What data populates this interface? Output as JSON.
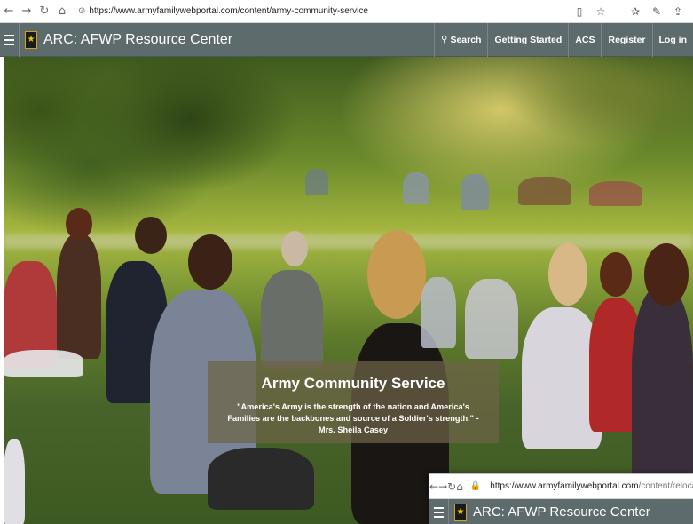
{
  "browser": {
    "url": "https://www.armyfamilywebportal.com/content/army-community-service",
    "back_icon": "←",
    "forward_icon": "→",
    "refresh_icon": "↻",
    "home_icon": "⌂",
    "lock_icon": "🔒"
  },
  "site": {
    "title": "ARC: AFWP Resource Center",
    "logo_glyph": "★",
    "nav": [
      {
        "label": "Search",
        "icon": "🔍"
      },
      {
        "label": "Getting Started"
      },
      {
        "label": "ACS"
      },
      {
        "label": "Register"
      },
      {
        "label": "Log in"
      }
    ]
  },
  "hero": {
    "heading": "Army Community Service",
    "quote": "\"America's Army is the strength of the nation and America's Families are the backbones and source of a Soldier's strength.\" - Mrs. Sheila Casey"
  },
  "second_window": {
    "url_host": "https://www.armyfamilywebportal.com",
    "url_path": "/content/relocation-readiness",
    "title": "ARC: AFWP Resource Center"
  },
  "colors": {
    "header_bg": "#5d6b6d",
    "caption_bg": "rgba(110,100,70,0.72)"
  }
}
